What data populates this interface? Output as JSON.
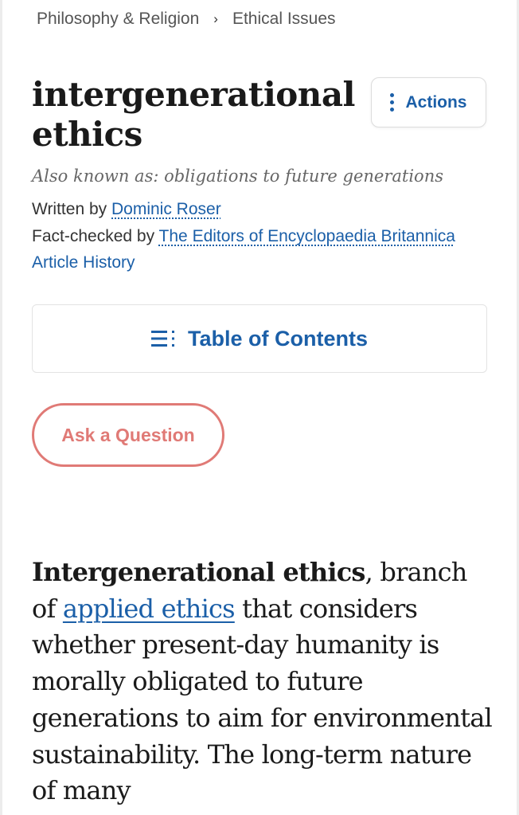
{
  "breadcrumb": {
    "items": [
      "Philosophy & Religion",
      "Ethical Issues"
    ],
    "separator": "›"
  },
  "article": {
    "title": "intergenerational ethics",
    "also_known_as": "Also known as: obligations to future generations",
    "written_by_label": "Written by",
    "author": "Dominic Roser",
    "fact_checked_label": "Fact-checked by",
    "fact_checker": "The Editors of Encyclopaedia Britannica",
    "history_link": "Article History"
  },
  "actions": {
    "label": "Actions",
    "icon": "kebab-icon"
  },
  "toc": {
    "label": "Table of Contents",
    "icon": "list-icon"
  },
  "ask": {
    "label": "Ask a Question"
  },
  "body": {
    "lead_term": "Intergenerational ethics",
    "after_lead": ", branch of ",
    "link_text": "applied ethics",
    "rest": " that considers whether present-day humanity is morally obligated to future generations to aim for environmental sustainability. The long-term nature of many"
  },
  "colors": {
    "link": "#1b5fa8",
    "ask_accent": "#e07a76",
    "text": "#1a1a1a",
    "muted": "#666666"
  }
}
